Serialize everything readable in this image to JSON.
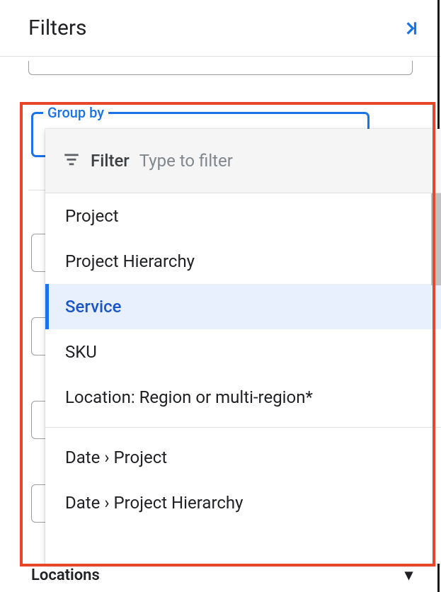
{
  "header": {
    "title": "Filters"
  },
  "groupby": {
    "legend": "Group by"
  },
  "dropdown": {
    "filter_label": "Filter",
    "filter_placeholder": "Type to filter",
    "options_group1": [
      "Project",
      "Project Hierarchy",
      "Service",
      "SKU",
      "Location: Region or multi-region*"
    ],
    "selected_index": 2,
    "options_group2": [
      "Date › Project",
      "Date › Project Hierarchy"
    ]
  },
  "locations": {
    "label": "Locations"
  }
}
